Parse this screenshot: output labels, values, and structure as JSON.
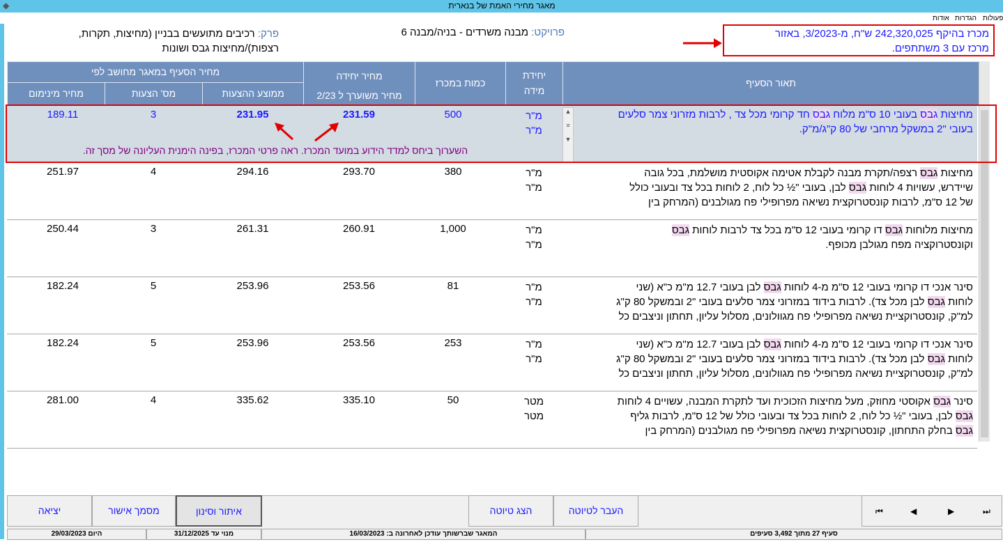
{
  "window": {
    "title": "מאגר מחירי האמת של בנארית"
  },
  "menu": [
    "פעולות",
    "הגדרות",
    "אודות"
  ],
  "project": {
    "label": "פרויקט:",
    "value": "מבנה משרדים - בניה/מבנה 6"
  },
  "chapter": {
    "label": "פרק:",
    "value_line1": "רכיבים מתועשים בבניין (מחיצות, תקרות,",
    "value_line2": "רצפות)/מחיצות גבס ושונות"
  },
  "tender_info": {
    "line1": "מכרז בהיקף 242,320,025 ש\"ח, מ-3/2023, באזור",
    "line2": "מרכז עם 3 משתתפים."
  },
  "headers": {
    "description": "תאור הסעיף",
    "unit_line1": "יחידת",
    "unit_line2": "מידה",
    "quantity": "כמות  במכרז",
    "unit_price_line1": "מחיר יחידה",
    "unit_price_line2": "מחיר משוערך ל 2/23",
    "db_price": "מחיר הסעיף במאגר מחושב לפי",
    "avg_bids": "ממוצע ההצעות",
    "num_bids": "מס' הצעות",
    "min_price": "מחיר מינימום"
  },
  "rows": [
    {
      "desc": [
        "מחיצות גבס בעובי 10 ס\"מ מלוח גבס  חד קרומי מכל צד , לרבות מזרוני צמר סלעים",
        "בעובי \"2 במשקל מרחבי של 80 ק\"ג/מ\"ק."
      ],
      "unit1": "מ\"ר",
      "unit2": "מ\"ר",
      "qty": "500",
      "unit_price": "231.59",
      "avg": "231.95",
      "count": "3",
      "min": "189.11"
    },
    {
      "desc": [
        "מחיצות גבס רצפה/תקרת מבנה לקבלת אטימה אקוסטית מושלמת, בכל גובה",
        "שיידרש, עשויות 4 לוחות גבס לבן, בעובי \"½ כל לוח, 2 לוחות בכל צד ובעובי כולל",
        "של 12 ס\"מ, לרבות קונסטרוקצית נשיאה מפרופילי פח מגולבנים (המרחק בין"
      ],
      "unit1": "מ\"ר",
      "unit2": "מ\"ר",
      "qty": "380",
      "unit_price": "293.70",
      "avg": "294.16",
      "count": "4",
      "min": "251.97"
    },
    {
      "desc": [
        "מחיצות מלוחות גבס דו קרומי בעובי 12 ס\"מ בכל צד לרבות לוחות גבס",
        "וקונסטרוקציה מפח מגולבן מכופף."
      ],
      "unit1": "מ\"ר",
      "unit2": "מ\"ר",
      "qty": "1,000",
      "unit_price": "260.91",
      "avg": "261.31",
      "count": "3",
      "min": "250.44"
    },
    {
      "desc": [
        "סינר אנכי דו קרומי בעובי 12 ס\"מ מ-4 לוחות גבס לבן בעובי 12.7 מ\"מ כ\"א (שני",
        "לוחות גבס לבן מכל צד). לרבות בידוד במזרוני צמר סלעים בעובי \"2 ובמשקל 80 ק\"ג",
        "למ\"ק, קונסטרוקציית נשיאה מפרופילי פח מגוולונים, מסלול עליון, תחתון וניצבים כל"
      ],
      "unit1": "מ\"ר",
      "unit2": "מ\"ר",
      "qty": "81",
      "unit_price": "253.56",
      "avg": "253.96",
      "count": "5",
      "min": "182.24"
    },
    {
      "desc": [
        "סינר אנכי דו קרומי בעובי 12 ס\"מ מ-4 לוחות גבס לבן בעובי 12.7 מ\"מ כ\"א (שני",
        "לוחות גבס לבן מכל צד). לרבות בידוד במזרוני צמר סלעים בעובי \"2 ובמשקל 80 ק\"ג",
        "למ\"ק, קונסטרוקציית נשיאה מפרופילי פח מגוולונים, מסלול עליון, תחתון וניצבים כל"
      ],
      "unit1": "מ\"ר",
      "unit2": "מ\"ר",
      "qty": "253",
      "unit_price": "253.56",
      "avg": "253.96",
      "count": "5",
      "min": "182.24"
    },
    {
      "desc": [
        "סינר גבס אקוסטי מחוזק, מעל מחיצות הזכוכית ועד לתקרת המבנה, עשויים 4 לוחות",
        "גבס לבן, בעובי \"½ כל לוח, 2 לוחות בכל צד ובעובי כולל של 12 ס\"מ, לרבות גליף",
        "גבס בחלק התחתון, קונסטרוקצית נשיאה מפרופילי פח מגולבנים (המרחק בין"
      ],
      "unit1": "מטר",
      "unit2": "מטר",
      "qty": "50",
      "unit_price": "335.10",
      "avg": "335.62",
      "count": "4",
      "min": "281.00"
    }
  ],
  "selected_note": "השערוך ביחס למדד הידוע במועד המכרז. ראה פרטי המכרז, בפינה הימנית העליונה של מסך זה.",
  "buttons": {
    "exit": "יציאה",
    "approval": "מסמך אישור",
    "filter": "איתור וסינון",
    "show_draft": "הצג טיוטה",
    "to_draft": "העבר לטיוטה"
  },
  "nav": {
    "first": "⏮",
    "prev": "◀",
    "next": "▶",
    "last": "⏭"
  },
  "status": {
    "today": "היום 29/03/2023",
    "subscription": "מנוי עד  31/12/2025",
    "updated": "המאגר שברשותך עודכן לאחרונה ב: 16/03/2023",
    "record": "סעיף 27 מתוך 3,492 סעיפים"
  },
  "colors": {
    "header": "#6f8fbd",
    "selected": "#d3dbe3",
    "highlight": "#f2d8ee",
    "accent": "#1a1aff",
    "red": "#e00000"
  }
}
